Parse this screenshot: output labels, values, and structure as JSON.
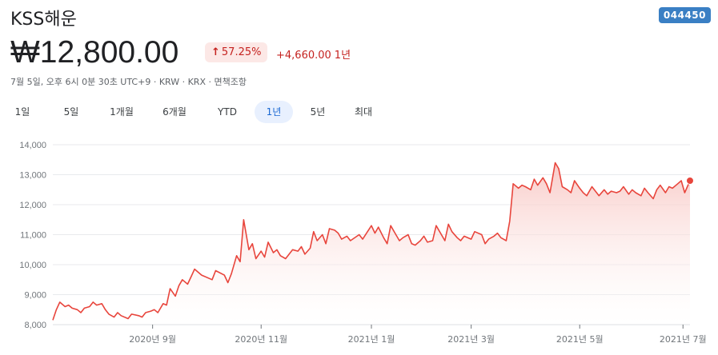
{
  "header": {
    "title": "KSS해운",
    "ticker": "044450",
    "price": "₩12,800.00",
    "pct_change": "57.25%",
    "change": "+4,660.00",
    "change_period": "1년",
    "meta": "7월 5일, 오후 6시 0분 30초 UTC+9 · KRW · KRX · 면책조항"
  },
  "tabs": [
    "1일",
    "5일",
    "1개월",
    "6개월",
    "YTD",
    "1년",
    "5년",
    "최대"
  ],
  "active_tab": "1년",
  "colors": {
    "line": "#e8453c",
    "fill_top": "#f8c5c1",
    "ticker_bg": "#3a7fc4",
    "active_tab": "#e8f0fe"
  },
  "chart_data": {
    "type": "area",
    "ylim": [
      8000,
      14000
    ],
    "yticks": [
      8000,
      9000,
      10000,
      11000,
      12000,
      13000,
      14000
    ],
    "ytick_labels": [
      "8,000",
      "9,000",
      "10,000",
      "11,000",
      "12,000",
      "13,000",
      "14,000"
    ],
    "xtick_labels": [
      "2020년 9월",
      "2020년 11월",
      "2021년 1월",
      "2021년 3월",
      "2021년 5월",
      "2021년 7월"
    ],
    "xtick_dates": [
      "2020-09-01",
      "2020-11-02",
      "2021-01-04",
      "2021-03-02",
      "2021-05-03",
      "2021-07-01"
    ],
    "series": [
      {
        "dates": [
          "2020-07-06",
          "2020-07-08",
          "2020-07-10",
          "2020-07-13",
          "2020-07-15",
          "2020-07-17",
          "2020-07-20",
          "2020-07-22",
          "2020-07-24",
          "2020-07-27",
          "2020-07-29",
          "2020-07-31",
          "2020-08-03",
          "2020-08-05",
          "2020-08-07",
          "2020-08-10",
          "2020-08-12",
          "2020-08-14",
          "2020-08-18",
          "2020-08-20",
          "2020-08-24",
          "2020-08-26",
          "2020-08-28",
          "2020-08-31",
          "2020-09-02",
          "2020-09-04",
          "2020-09-07",
          "2020-09-09",
          "2020-09-11",
          "2020-09-14",
          "2020-09-16",
          "2020-09-18",
          "2020-09-21",
          "2020-09-23",
          "2020-09-25",
          "2020-09-29",
          "2020-10-05",
          "2020-10-07",
          "2020-10-12",
          "2020-10-14",
          "2020-10-16",
          "2020-10-19",
          "2020-10-21",
          "2020-10-23",
          "2020-10-26",
          "2020-10-28",
          "2020-10-30",
          "2020-11-02",
          "2020-11-04",
          "2020-11-06",
          "2020-11-09",
          "2020-11-11",
          "2020-11-13",
          "2020-11-16",
          "2020-11-18",
          "2020-11-20",
          "2020-11-23",
          "2020-11-25",
          "2020-11-27",
          "2020-11-30",
          "2020-12-02",
          "2020-12-04",
          "2020-12-07",
          "2020-12-09",
          "2020-12-11",
          "2020-12-14",
          "2020-12-16",
          "2020-12-18",
          "2020-12-21",
          "2020-12-23",
          "2020-12-28",
          "2020-12-30",
          "2021-01-04",
          "2021-01-06",
          "2021-01-08",
          "2021-01-11",
          "2021-01-13",
          "2021-01-15",
          "2021-01-18",
          "2021-01-20",
          "2021-01-22",
          "2021-01-25",
          "2021-01-27",
          "2021-01-29",
          "2021-02-01",
          "2021-02-03",
          "2021-02-05",
          "2021-02-08",
          "2021-02-10",
          "2021-02-15",
          "2021-02-17",
          "2021-02-19",
          "2021-02-22",
          "2021-02-24",
          "2021-02-26",
          "2021-03-02",
          "2021-03-04",
          "2021-03-08",
          "2021-03-10",
          "2021-03-12",
          "2021-03-15",
          "2021-03-17",
          "2021-03-19",
          "2021-03-22",
          "2021-03-24",
          "2021-03-26",
          "2021-03-29",
          "2021-03-31",
          "2021-04-02",
          "2021-04-05",
          "2021-04-07",
          "2021-04-09",
          "2021-04-12",
          "2021-04-14",
          "2021-04-16",
          "2021-04-19",
          "2021-04-21",
          "2021-04-23",
          "2021-04-26",
          "2021-04-28",
          "2021-04-30",
          "2021-05-03",
          "2021-05-05",
          "2021-05-07",
          "2021-05-10",
          "2021-05-12",
          "2021-05-14",
          "2021-05-17",
          "2021-05-19",
          "2021-05-21",
          "2021-05-24",
          "2021-05-26",
          "2021-05-28",
          "2021-05-31",
          "2021-06-02",
          "2021-06-04",
          "2021-06-07",
          "2021-06-09",
          "2021-06-11",
          "2021-06-14",
          "2021-06-16",
          "2021-06-18",
          "2021-06-21",
          "2021-06-23",
          "2021-06-25",
          "2021-06-28",
          "2021-06-30",
          "2021-07-02",
          "2021-07-05"
        ],
        "values": [
          8150,
          8500,
          8750,
          8600,
          8650,
          8550,
          8500,
          8400,
          8550,
          8600,
          8750,
          8650,
          8700,
          8500,
          8350,
          8250,
          8400,
          8300,
          8200,
          8350,
          8300,
          8250,
          8400,
          8450,
          8500,
          8400,
          8700,
          8650,
          9200,
          8950,
          9300,
          9500,
          9350,
          9600,
          9850,
          9650,
          9500,
          9800,
          9650,
          9400,
          9700,
          10300,
          10100,
          11500,
          10500,
          10700,
          10200,
          10450,
          10250,
          10750,
          10400,
          10500,
          10300,
          10200,
          10350,
          10500,
          10450,
          10600,
          10350,
          10550,
          11100,
          10800,
          11000,
          10700,
          11200,
          11150,
          11050,
          10850,
          10950,
          10800,
          11000,
          10850,
          11300,
          11050,
          11250,
          10900,
          10700,
          11300,
          11000,
          10800,
          10900,
          11000,
          10700,
          10650,
          10800,
          10950,
          10750,
          10800,
          11300,
          10800,
          11350,
          11100,
          10900,
          10800,
          10950,
          10850,
          11100,
          11000,
          10700,
          10850,
          10950,
          11050,
          10900,
          10800,
          11450,
          12700,
          12550,
          12650,
          12600,
          12500,
          12850,
          12650,
          12900,
          12700,
          12400,
          13400,
          13200,
          12600,
          12500,
          12400,
          12800,
          12550,
          12400,
          12300,
          12600,
          12450,
          12300,
          12500,
          12350,
          12450,
          12400,
          12450,
          12600,
          12350,
          12500,
          12400,
          12300,
          12550,
          12400,
          12200,
          12500,
          12650,
          12400,
          12600,
          12550,
          12700,
          12800,
          12400,
          12800
        ]
      }
    ]
  }
}
